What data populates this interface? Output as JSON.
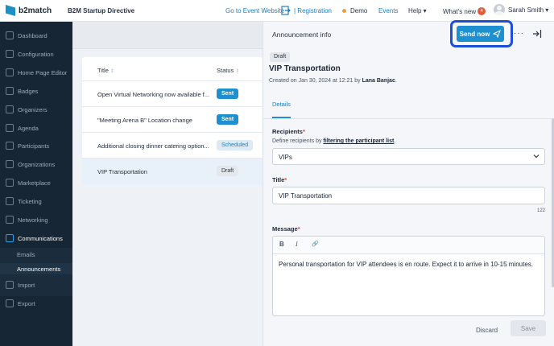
{
  "header": {
    "logo_text": "b2match",
    "event_name": "B2M Startup Directive",
    "goto_event": "Go to Event Website",
    "registration": "| Registration",
    "demo": "Demo",
    "events": "Events",
    "help": "Help ▾",
    "whats_new": "What's new",
    "whats_new_count": "4",
    "user_name": "Sarah Smith ▾",
    "accent": "#1e8fcf"
  },
  "sidebar": {
    "items": [
      {
        "label": "Dashboard",
        "icon": "dashboard-icon"
      },
      {
        "label": "Configuration",
        "icon": "configuration-icon"
      },
      {
        "label": "Home Page Editor",
        "icon": "home-page-editor-icon"
      },
      {
        "label": "Badges",
        "icon": "badges-icon"
      },
      {
        "label": "Organizers",
        "icon": "organizers-icon"
      },
      {
        "label": "Agenda",
        "icon": "agenda-icon"
      },
      {
        "label": "Participants",
        "icon": "participants-icon"
      },
      {
        "label": "Organizations",
        "icon": "organizations-icon"
      },
      {
        "label": "Marketplace",
        "icon": "marketplace-icon"
      },
      {
        "label": "Ticketing",
        "icon": "ticketing-icon"
      },
      {
        "label": "Networking",
        "icon": "networking-icon"
      },
      {
        "label": "Communications",
        "icon": "communications-icon"
      },
      {
        "label": "Import",
        "icon": "import-icon"
      },
      {
        "label": "Export",
        "icon": "export-icon"
      }
    ],
    "sub_items": [
      {
        "label": "Emails"
      },
      {
        "label": "Announcements"
      }
    ]
  },
  "list": {
    "col_title": "Title",
    "col_status": "Status",
    "rows": [
      {
        "title": "Open Virtual Networking now available f...",
        "status": "Sent"
      },
      {
        "title": "\"Meeting Arena B\" Location change",
        "status": "Sent"
      },
      {
        "title": "Additional closing dinner catering option...",
        "status": "Scheduled"
      },
      {
        "title": "VIP Transportation",
        "status": "Draft"
      }
    ]
  },
  "panel": {
    "title": "Announcement info",
    "send_now": "Send now",
    "more": "···",
    "status_tag": "Draft",
    "announcement_title": "VIP Transportation",
    "created_prefix": "Created on Jan 30, 2024 at 12:21 by ",
    "created_by": "Lana Banjac",
    "created_suffix": ".",
    "tab_details": "Details",
    "recipients_label": "Recipients",
    "required_mark": "*",
    "recipients_hint_prefix": "Define recipients by ",
    "recipients_hint_link": "filtering the participant list",
    "recipients_hint_suffix": ".",
    "recipients_value": "VIPs",
    "title_label": "Title",
    "title_value": "VIP Transportation",
    "title_counter": "122",
    "message_label": "Message",
    "toolbar": {
      "bold": "B",
      "italic": "I",
      "link": "🔗"
    },
    "message_value": "Personal transportation for VIP attendees is en route. Expect it to arrive in 10-15 minutes.",
    "discard": "Discard",
    "save": "Save"
  }
}
